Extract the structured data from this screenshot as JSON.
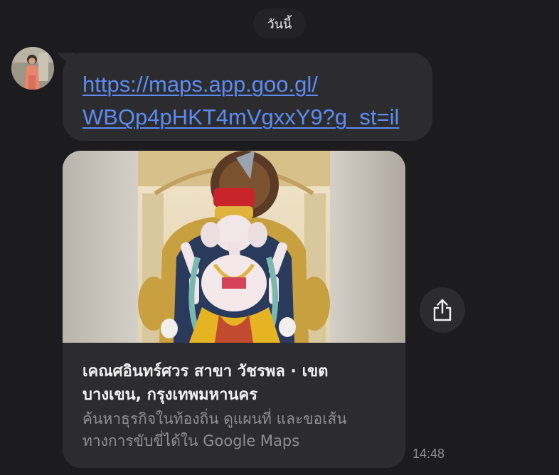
{
  "chat": {
    "date_label": "วันนี้",
    "message": {
      "link_line1": "https://maps.app.goo.gl/",
      "link_line2": "WBQp4pHKT4mVgxxY9?g_st=il"
    },
    "preview": {
      "title": "เคณศอินทร์ศวร สาขา วัชรพล · เขต บางเขน, กรุงเทพมหานคร",
      "description": "ค้นหาธุรกิจในท้องถิ่น ดูแผนที่ และขอเส้นทางการขับขี่ได้ใน Google Maps"
    },
    "timestamp": "14:48"
  },
  "icons": {
    "share": "share-icon",
    "avatar": "avatar"
  },
  "colors": {
    "background": "#1c1c1e",
    "bubble": "#2c2c2e",
    "link": "#5b8cf5",
    "secondary_text": "#8e8e93"
  }
}
